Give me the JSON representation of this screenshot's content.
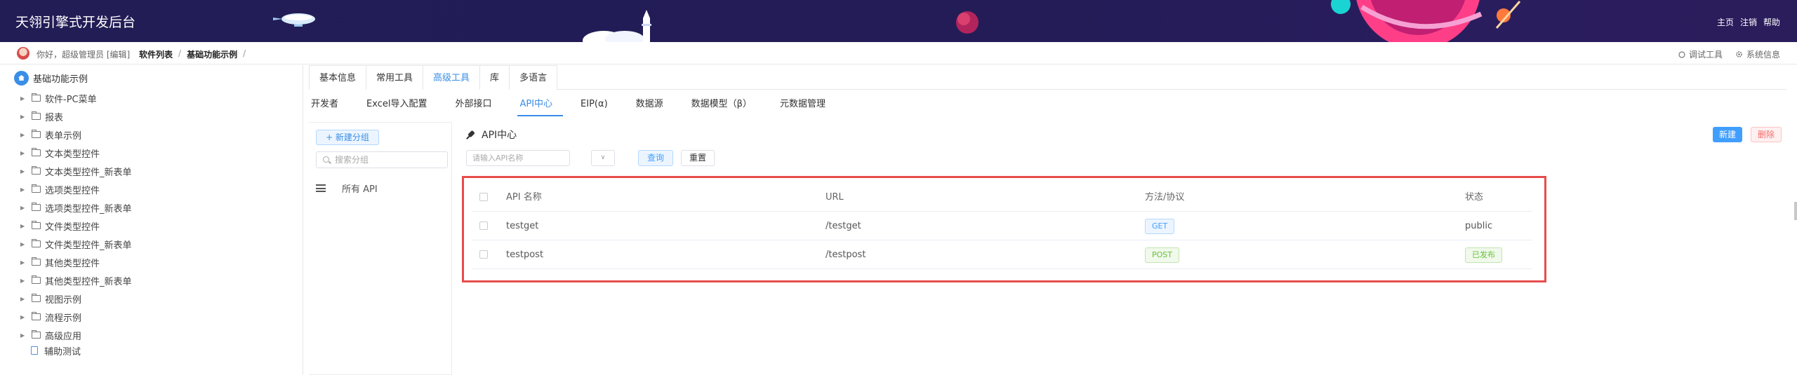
{
  "header": {
    "app_title": "天翎引擎式开发后台",
    "nav": [
      "主页",
      "注销",
      "帮助"
    ]
  },
  "subbar": {
    "greeting": "你好，超级管理员 [编辑]",
    "breadcrumb": [
      "软件列表",
      "基础功能示例"
    ],
    "breadcrumb_sep": "/",
    "tools": {
      "debug": "调试工具",
      "system": "系统信息"
    }
  },
  "tree": {
    "root": "基础功能示例",
    "items": [
      "软件-PC菜单",
      "报表",
      "表单示例",
      "文本类型控件",
      "文本类型控件_新表单",
      "选项类型控件",
      "选项类型控件_新表单",
      "文件类型控件",
      "文件类型控件_新表单",
      "其他类型控件",
      "其他类型控件_新表单",
      "视图示例",
      "流程示例",
      "高级应用"
    ],
    "file_item": "辅助测试"
  },
  "tabs_primary": [
    "基本信息",
    "常用工具",
    "高级工具",
    "库",
    "多语言"
  ],
  "tabs_primary_active": 2,
  "tabs_secondary": [
    "开发者",
    "Excel导入配置",
    "外部接口",
    "API中心",
    "EIP(α)",
    "数据源",
    "数据模型（β）",
    "元数据管理"
  ],
  "tabs_secondary_active": 3,
  "group_panel": {
    "new_group": "+ 新建分组",
    "search_placeholder": "搜索分组",
    "all_api": "所有 API"
  },
  "api_center": {
    "title": "API中心",
    "create": "新建",
    "delete": "删除",
    "name_placeholder": "请输入API名称",
    "select_arrow": "∨",
    "query": "查询",
    "reset": "重置"
  },
  "table": {
    "columns": [
      "API 名称",
      "URL",
      "方法/协议",
      "状态"
    ],
    "rows": [
      {
        "name": "testget",
        "url": "/testget",
        "method": "GET",
        "status": "public"
      },
      {
        "name": "testpost",
        "url": "/testpost",
        "method": "POST",
        "status": "已发布"
      }
    ]
  },
  "colors": {
    "header_bg": "#221d55",
    "accent": "#409eff",
    "highlight_border": "#e74c4c"
  }
}
